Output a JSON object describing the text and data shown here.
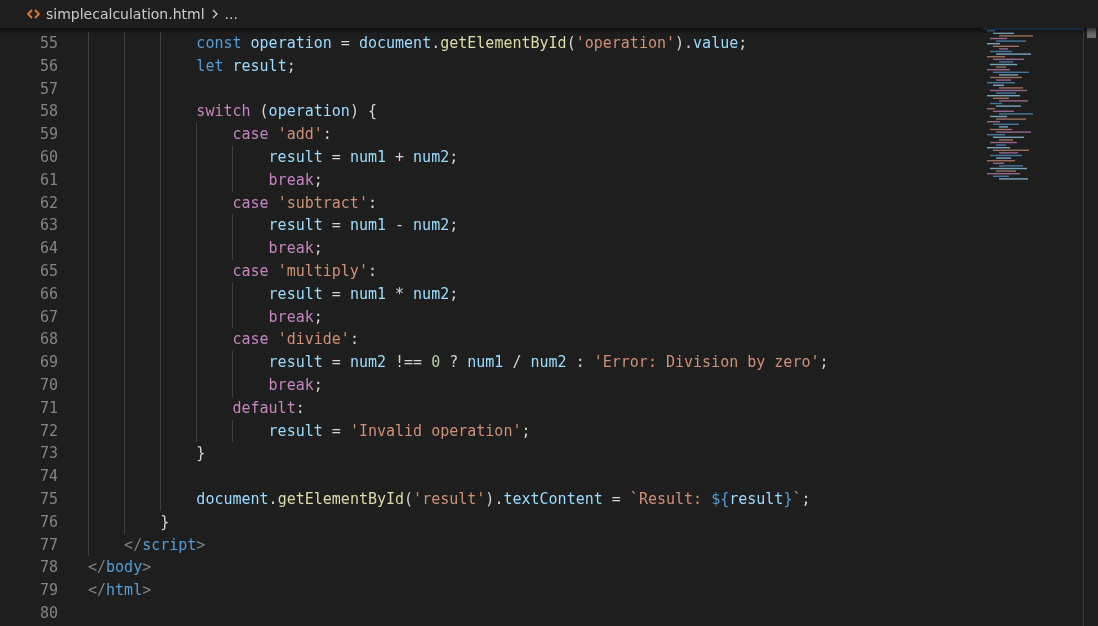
{
  "breadcrumb": {
    "file": "simplecalculation.html",
    "more": "..."
  },
  "lines": [
    {
      "children": [
        {
          "children": [
            {
              "children": [
                {
                  "number": "55",
                  "tokens": [
                    {
                      "kind": "keyword",
                      "text": "const "
                    },
                    {
                      "kind": "variable",
                      "text": "operation"
                    },
                    {
                      "kind": "plain",
                      "text": " = "
                    },
                    {
                      "kind": "variable",
                      "text": "document"
                    },
                    {
                      "kind": "plain",
                      "text": "."
                    },
                    {
                      "kind": "function",
                      "text": "getElementById"
                    },
                    {
                      "kind": "plain",
                      "text": "("
                    },
                    {
                      "kind": "string",
                      "text": "'operation'"
                    },
                    {
                      "kind": "plain",
                      "text": ")."
                    },
                    {
                      "kind": "variable",
                      "text": "value"
                    },
                    {
                      "kind": "plain",
                      "text": ";"
                    }
                  ]
                },
                {
                  "number": "56",
                  "tokens": [
                    {
                      "kind": "keyword",
                      "text": "let "
                    },
                    {
                      "kind": "variable",
                      "text": "result"
                    },
                    {
                      "kind": "plain",
                      "text": ";"
                    }
                  ]
                },
                {
                  "number": "57"
                },
                {
                  "number": "58",
                  "tokens": [
                    {
                      "kind": "control",
                      "text": "switch"
                    },
                    {
                      "kind": "plain",
                      "text": " ("
                    },
                    {
                      "kind": "variable",
                      "text": "operation"
                    },
                    {
                      "kind": "plain",
                      "text": ") {"
                    }
                  ]
                },
                {
                  "children": [
                    {
                      "number": "59",
                      "tokens": [
                        {
                          "kind": "control",
                          "text": "case "
                        },
                        {
                          "kind": "string",
                          "text": "'add'"
                        },
                        {
                          "kind": "plain",
                          "text": ":"
                        }
                      ]
                    },
                    {
                      "children": [
                        {
                          "number": "60",
                          "tokens": [
                            {
                              "kind": "variable",
                              "text": "result"
                            },
                            {
                              "kind": "plain",
                              "text": " = "
                            },
                            {
                              "kind": "variable",
                              "text": "num1"
                            },
                            {
                              "kind": "plain",
                              "text": " + "
                            },
                            {
                              "kind": "variable",
                              "text": "num2"
                            },
                            {
                              "kind": "plain",
                              "text": ";"
                            }
                          ]
                        },
                        {
                          "number": "61",
                          "tokens": [
                            {
                              "kind": "control",
                              "text": "break"
                            },
                            {
                              "kind": "plain",
                              "text": ";"
                            }
                          ]
                        }
                      ]
                    },
                    {
                      "number": "62",
                      "tokens": [
                        {
                          "kind": "control",
                          "text": "case "
                        },
                        {
                          "kind": "string",
                          "text": "'subtract'"
                        },
                        {
                          "kind": "plain",
                          "text": ":"
                        }
                      ]
                    },
                    {
                      "children": [
                        {
                          "number": "63",
                          "tokens": [
                            {
                              "kind": "variable",
                              "text": "result"
                            },
                            {
                              "kind": "plain",
                              "text": " = "
                            },
                            {
                              "kind": "variable",
                              "text": "num1"
                            },
                            {
                              "kind": "plain",
                              "text": " - "
                            },
                            {
                              "kind": "variable",
                              "text": "num2"
                            },
                            {
                              "kind": "plain",
                              "text": ";"
                            }
                          ]
                        },
                        {
                          "number": "64",
                          "tokens": [
                            {
                              "kind": "control",
                              "text": "break"
                            },
                            {
                              "kind": "plain",
                              "text": ";"
                            }
                          ]
                        }
                      ]
                    },
                    {
                      "number": "65",
                      "tokens": [
                        {
                          "kind": "control",
                          "text": "case "
                        },
                        {
                          "kind": "string",
                          "text": "'multiply'"
                        },
                        {
                          "kind": "plain",
                          "text": ":"
                        }
                      ]
                    },
                    {
                      "children": [
                        {
                          "number": "66",
                          "tokens": [
                            {
                              "kind": "variable",
                              "text": "result"
                            },
                            {
                              "kind": "plain",
                              "text": " = "
                            },
                            {
                              "kind": "variable",
                              "text": "num1"
                            },
                            {
                              "kind": "plain",
                              "text": " * "
                            },
                            {
                              "kind": "variable",
                              "text": "num2"
                            },
                            {
                              "kind": "plain",
                              "text": ";"
                            }
                          ]
                        },
                        {
                          "number": "67",
                          "tokens": [
                            {
                              "kind": "control",
                              "text": "break"
                            },
                            {
                              "kind": "plain",
                              "text": ";"
                            }
                          ]
                        }
                      ]
                    },
                    {
                      "number": "68",
                      "tokens": [
                        {
                          "kind": "control",
                          "text": "case "
                        },
                        {
                          "kind": "string",
                          "text": "'divide'"
                        },
                        {
                          "kind": "plain",
                          "text": ":"
                        }
                      ]
                    },
                    {
                      "children": [
                        {
                          "number": "69",
                          "tokens": [
                            {
                              "kind": "variable",
                              "text": "result"
                            },
                            {
                              "kind": "plain",
                              "text": " = "
                            },
                            {
                              "kind": "variable",
                              "text": "num2"
                            },
                            {
                              "kind": "plain",
                              "text": " !== "
                            },
                            {
                              "kind": "number",
                              "text": "0"
                            },
                            {
                              "kind": "plain",
                              "text": " ? "
                            },
                            {
                              "kind": "variable",
                              "text": "num1"
                            },
                            {
                              "kind": "plain",
                              "text": " / "
                            },
                            {
                              "kind": "variable",
                              "text": "num2"
                            },
                            {
                              "kind": "plain",
                              "text": " : "
                            },
                            {
                              "kind": "string",
                              "text": "'Error: Division by zero'"
                            },
                            {
                              "kind": "plain",
                              "text": ";"
                            }
                          ]
                        },
                        {
                          "number": "70",
                          "tokens": [
                            {
                              "kind": "control",
                              "text": "break"
                            },
                            {
                              "kind": "plain",
                              "text": ";"
                            }
                          ]
                        }
                      ]
                    },
                    {
                      "number": "71",
                      "tokens": [
                        {
                          "kind": "control",
                          "text": "default"
                        },
                        {
                          "kind": "plain",
                          "text": ":"
                        }
                      ]
                    },
                    {
                      "children": [
                        {
                          "number": "72",
                          "tokens": [
                            {
                              "kind": "variable",
                              "text": "result"
                            },
                            {
                              "kind": "plain",
                              "text": " = "
                            },
                            {
                              "kind": "string",
                              "text": "'Invalid operation'"
                            },
                            {
                              "kind": "plain",
                              "text": ";"
                            }
                          ]
                        }
                      ]
                    }
                  ]
                },
                {
                  "number": "73",
                  "tokens": [
                    {
                      "kind": "plain",
                      "text": "}"
                    }
                  ]
                },
                {
                  "number": "74"
                },
                {
                  "number": "75",
                  "tokens": [
                    {
                      "kind": "variable",
                      "text": "document"
                    },
                    {
                      "kind": "plain",
                      "text": "."
                    },
                    {
                      "kind": "function",
                      "text": "getElementById"
                    },
                    {
                      "kind": "plain",
                      "text": "("
                    },
                    {
                      "kind": "string",
                      "text": "'result'"
                    },
                    {
                      "kind": "plain",
                      "text": ")."
                    },
                    {
                      "kind": "variable",
                      "text": "textContent"
                    },
                    {
                      "kind": "plain",
                      "text": " = "
                    },
                    {
                      "kind": "string",
                      "text": "`Result: "
                    },
                    {
                      "kind": "keyword",
                      "text": "${"
                    },
                    {
                      "kind": "variable",
                      "text": "result"
                    },
                    {
                      "kind": "keyword",
                      "text": "}"
                    },
                    {
                      "kind": "string",
                      "text": "`"
                    },
                    {
                      "kind": "plain",
                      "text": ";"
                    }
                  ]
                }
              ]
            },
            {
              "number": "76",
              "tokens": [
                {
                  "kind": "plain",
                  "text": "}"
                }
              ]
            }
          ]
        },
        {
          "number": "77",
          "tokens": [
            {
              "kind": "tag-bracket",
              "text": "</"
            },
            {
              "kind": "tag",
              "text": "script"
            },
            {
              "kind": "tag-bracket",
              "text": ">"
            }
          ]
        }
      ]
    },
    {
      "number": "78",
      "tokens": [
        {
          "kind": "tag-bracket",
          "text": "</"
        },
        {
          "kind": "tag",
          "text": "body"
        },
        {
          "kind": "tag-bracket",
          "text": ">"
        }
      ]
    },
    {
      "number": "79",
      "tokens": [
        {
          "kind": "tag-bracket",
          "text": "</"
        },
        {
          "kind": "tag",
          "text": "html"
        },
        {
          "kind": "tag-bracket",
          "text": ">"
        }
      ]
    },
    {
      "number": "80"
    }
  ]
}
